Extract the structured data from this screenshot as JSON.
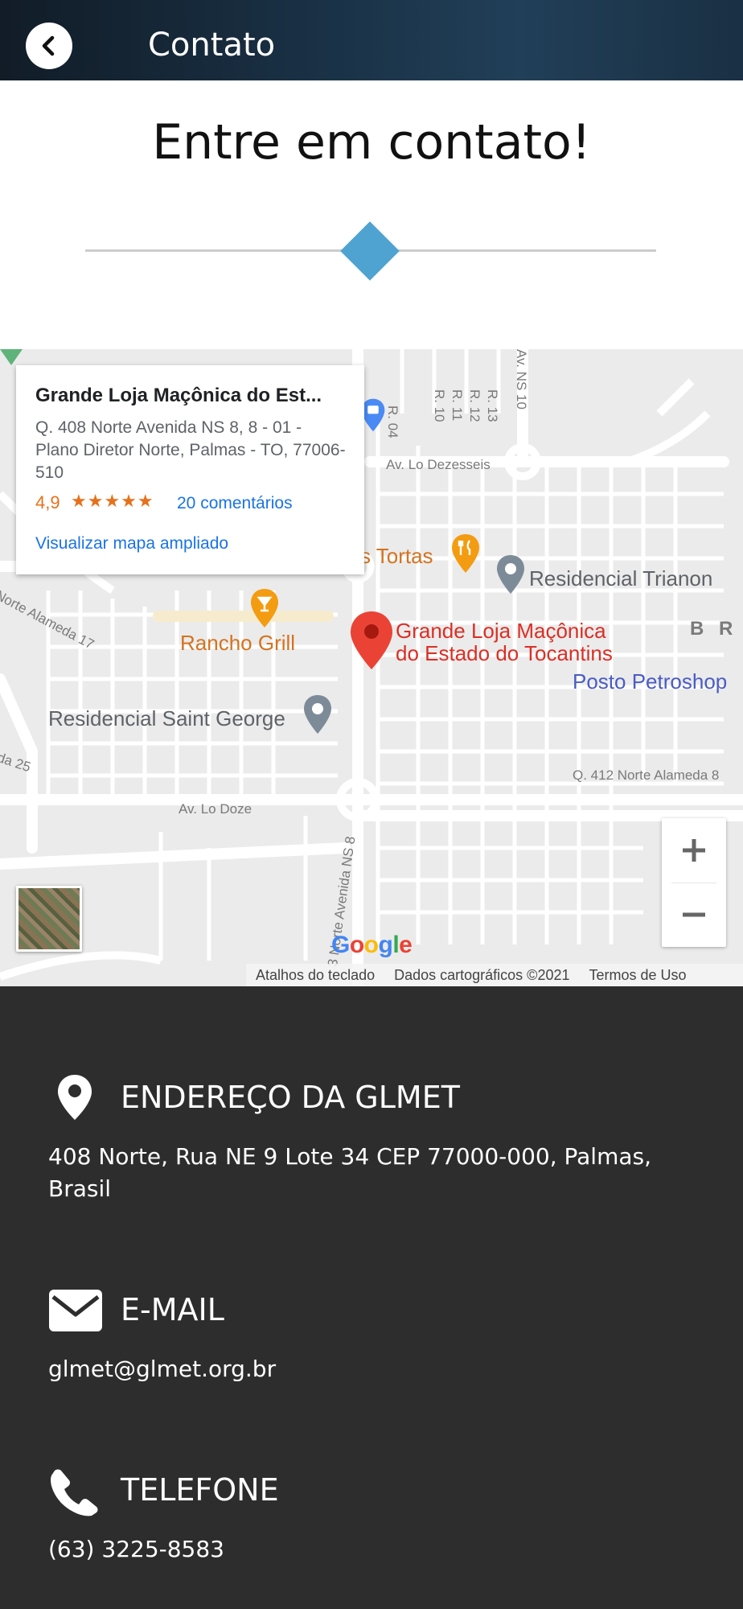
{
  "header": {
    "title": "Contato",
    "back_icon": "chevron-left-icon"
  },
  "hero": {
    "title": "Entre em contato!",
    "accent_color": "#4fa3d1"
  },
  "map": {
    "info_card": {
      "name": "Grande Loja Maçônica do Est...",
      "address": "Q. 408 Norte Avenida NS 8, 8 - 01 - Plano Diretor Norte, Palmas - TO, 77006-510",
      "rating": "4,9",
      "stars": "★★★★★",
      "reviews": "20 comentários",
      "view_larger": "Visualizar mapa ampliado"
    },
    "labels": {
      "tortas": "s Tortas",
      "residencial_trianon": "Residencial Trianon",
      "rancho_grill": "Rancho Grill",
      "loja_line1": "Grande Loja Maçônica",
      "loja_line2": "do Estado do Tocantins",
      "brev": "B R E",
      "posto": "Posto Petroshop",
      "residencial_saint_george": "Residencial Saint George",
      "av_lo_dezesseis": "Av. Lo Dezesseis",
      "av_lo_doze": "Av. Lo Doze",
      "q412": "Q. 412 Norte Alameda 8",
      "norte_alameda_17": "Norte Alameda 17",
      "da_25": "da 25",
      "r04": "R. 04",
      "r10": "R. 10",
      "r11": "R. 11",
      "r12": "R. 12",
      "r13": "R. 13",
      "av_ns10": "Av. NS 10",
      "norte_avenida_ns8": "3 Norte Avenida NS 8"
    },
    "google_logo": [
      "G",
      "o",
      "o",
      "g",
      "l",
      "e"
    ],
    "attribution": {
      "shortcuts": "Atalhos do teclado",
      "data": "Dados cartográficos ©2021",
      "terms": "Termos de Uso"
    },
    "zoom_in": "+",
    "zoom_out": "−"
  },
  "contact": {
    "address": {
      "icon": "location-pin-icon",
      "heading": "ENDEREÇO DA GLMET",
      "value": "408 Norte, Rua NE 9 Lote 34 CEP 77000-000, Palmas, Brasil"
    },
    "email": {
      "icon": "envelope-icon",
      "heading": "E-MAIL",
      "value": "glmet@glmet.org.br"
    },
    "phone": {
      "icon": "phone-icon",
      "heading": "TELEFONE",
      "value": "(63) 3225-8583"
    }
  }
}
